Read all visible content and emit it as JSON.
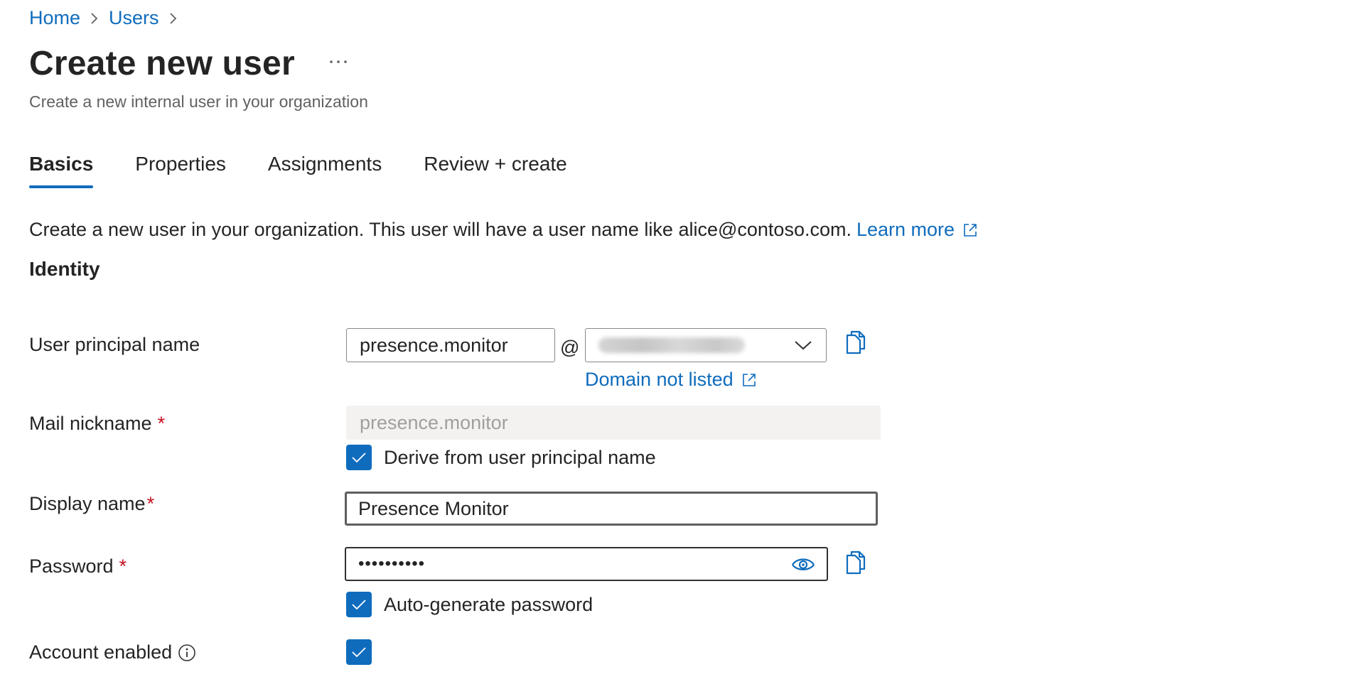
{
  "breadcrumb": {
    "items": [
      {
        "label": "Home"
      },
      {
        "label": "Users"
      }
    ]
  },
  "header": {
    "title": "Create new user",
    "more_label": "More options",
    "subtitle": "Create a new internal user in your organization"
  },
  "tabs": [
    {
      "label": "Basics",
      "active": true
    },
    {
      "label": "Properties",
      "active": false
    },
    {
      "label": "Assignments",
      "active": false
    },
    {
      "label": "Review + create",
      "active": false
    }
  ],
  "intro": {
    "text": "Create a new user in your organization. This user will have a user name like alice@contoso.com.",
    "learn_more": "Learn more"
  },
  "section": {
    "title": "Identity"
  },
  "form": {
    "upn": {
      "label": "User principal name",
      "value": "presence.monitor",
      "at": "@",
      "domain_blurred": true,
      "domain_not_listed": "Domain not listed"
    },
    "mail_nickname": {
      "label": "Mail nickname",
      "required_mark": "*",
      "value": "presence.monitor",
      "derive_label": "Derive from user principal name",
      "derive_checked": true
    },
    "display_name": {
      "label": "Display name",
      "required_mark": "*",
      "value": "Presence Monitor"
    },
    "password": {
      "label": "Password",
      "required_mark": "*",
      "value": "••••••••••",
      "auto_generate_label": "Auto-generate password",
      "auto_generate_checked": true
    },
    "account_enabled": {
      "label": "Account enabled",
      "checked": true
    }
  },
  "colors": {
    "accent": "#0f6cbd",
    "required": "#c50f1f",
    "text": "#242424",
    "muted": "#616161"
  }
}
